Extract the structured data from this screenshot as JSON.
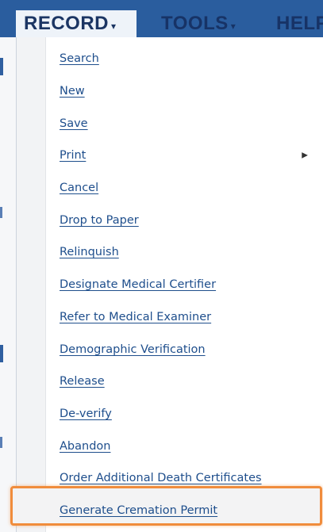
{
  "menubar": {
    "record": "RECORD",
    "tools": "TOOLS",
    "help": "HELP",
    "caret": "▾"
  },
  "dropdown": {
    "items": [
      {
        "label": "Search"
      },
      {
        "label": "New"
      },
      {
        "label": "Save"
      },
      {
        "label": "Print",
        "has_submenu": true
      },
      {
        "label": "Cancel"
      },
      {
        "label": "Drop to Paper"
      },
      {
        "label": "Relinquish"
      },
      {
        "label": "Designate Medical Certifier"
      },
      {
        "label": "Refer to Medical Examiner"
      },
      {
        "label": "Demographic Verification"
      },
      {
        "label": "Release"
      },
      {
        "label": "De-verify"
      },
      {
        "label": "Abandon"
      },
      {
        "label": "Order Additional Death Certificates"
      },
      {
        "label": "Generate Cremation Permit",
        "highlighted": true
      }
    ],
    "submenu_icon": "triangle-right-icon",
    "highlight_color": "#f08c3c"
  },
  "colors": {
    "menubar_bg": "#2a5d9e",
    "link": "#1e4e8c",
    "menu_text": "#173366"
  }
}
